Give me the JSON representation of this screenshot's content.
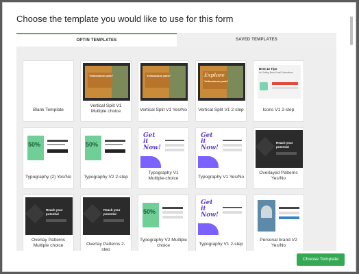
{
  "modal": {
    "title": "Choose the template you would like to use for this form"
  },
  "tabs": {
    "optin": "OPTIN TEMPLATES",
    "saved": "SAVED TEMPLATES"
  },
  "templates": [
    {
      "name": "Blank Template"
    },
    {
      "name": "Vertical Split V1 Multiple choice"
    },
    {
      "name": "Vertical Split V1 Yes/No"
    },
    {
      "name": "Vertical Split V1 2-step"
    },
    {
      "name": "Icons V1 2-step"
    },
    {
      "name": "Typography (2) Yes/No"
    },
    {
      "name": "Typography V2 2-step"
    },
    {
      "name": "Typography V1 Multiple-choice"
    },
    {
      "name": "Typography V1 Yes/No"
    },
    {
      "name": "Overlayed Patterns Yes/No"
    },
    {
      "name": "Overlay Patterns Multiple choice"
    },
    {
      "name": "Overlay Patterns 2-step"
    },
    {
      "name": "Typography V2 Multiple choice"
    },
    {
      "name": "Typography V1 2-step"
    },
    {
      "name": "Personal brand V2 Yes/No"
    }
  ],
  "thumb_text": {
    "yellowstone": "Yellowstone park?",
    "explore": "Explore",
    "best_tips": "Best 12 Tips",
    "tips_sub": "for Getting More Email Subscribers",
    "fifty": "50%",
    "get_it": "Get it Now!",
    "reach": "Reach your",
    "potential": "potential"
  },
  "footer": {
    "choose": "Choose Template"
  }
}
